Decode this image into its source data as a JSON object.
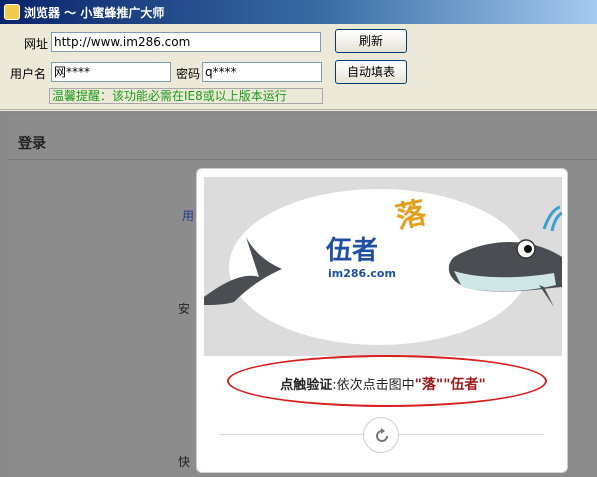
{
  "window": {
    "title": "浏览器 〜 小蜜蜂推广大师"
  },
  "toolbar": {
    "url_label": "网址",
    "url_value": "http://www.im286.com",
    "refresh_label": "刷新",
    "username_label": "用户名",
    "username_value": "网****",
    "password_label": "密码",
    "password_value": "q****",
    "autofill_label": "自动填表",
    "hint": "温馨提醒：该功能必需在IE8或以上版本运行"
  },
  "page": {
    "login_title": "登录",
    "frag_1": "用",
    "frag_2": "安",
    "frag_3": "快"
  },
  "captcha": {
    "image_text_logo": "伍者",
    "image_text_url": "im286.com",
    "image_text_char": "落",
    "instruction_bold": "点触验证",
    "instruction_text": ":依次点击图中",
    "target_1": "\"落\"",
    "target_2": "\"伍者\""
  },
  "colors": {
    "title_bar": "#0a246a",
    "hint_text": "#1a9a1a",
    "target_text": "#9b1a1a",
    "annotation_ellipse": "#d81e1e"
  }
}
